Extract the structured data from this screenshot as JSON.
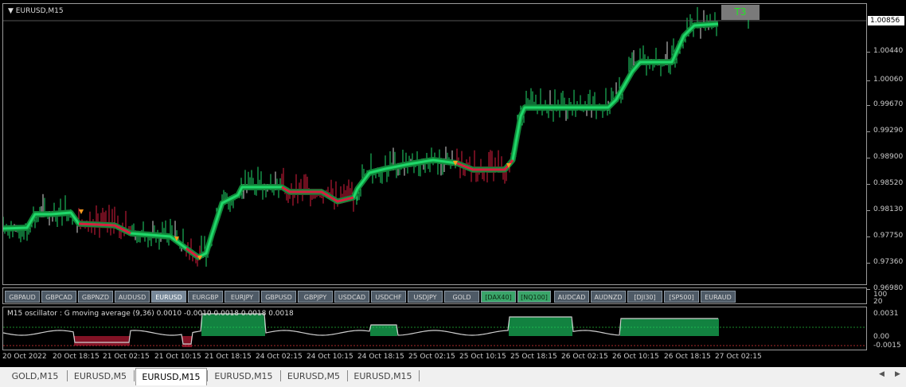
{
  "chart": {
    "title": "EURUSD,M15",
    "indicator_box": "T3",
    "current_price": "1.00856",
    "price_labels": [
      "1.00440",
      "1.00060",
      "0.99670",
      "0.99290",
      "0.98900",
      "0.98520",
      "0.98130",
      "0.97750",
      "0.97360",
      "0.96980"
    ],
    "colors": {
      "bull": "#1fd86a",
      "bear": "#d81e3e",
      "signal": "#ff9a1f",
      "neutral": "#d8d8d8"
    }
  },
  "symbol_buttons": [
    {
      "label": "GBPAUD",
      "state": "normal"
    },
    {
      "label": "GBPCAD",
      "state": "normal"
    },
    {
      "label": "GBPNZD",
      "state": "normal"
    },
    {
      "label": "AUDUSD",
      "state": "normal"
    },
    {
      "label": "EURUSD",
      "state": "active"
    },
    {
      "label": "EURGBP",
      "state": "normal"
    },
    {
      "label": "EURJPY",
      "state": "normal"
    },
    {
      "label": "GBPUSD",
      "state": "normal"
    },
    {
      "label": "GBPJPY",
      "state": "normal"
    },
    {
      "label": "USDCAD",
      "state": "normal"
    },
    {
      "label": "USDCHF",
      "state": "normal"
    },
    {
      "label": "USDJPY",
      "state": "normal"
    },
    {
      "label": "GOLD",
      "state": "normal"
    },
    {
      "label": "[DAX40]",
      "state": "green"
    },
    {
      "label": "[NQ100]",
      "state": "green"
    },
    {
      "label": "AUDCAD",
      "state": "normal"
    },
    {
      "label": "AUDNZD",
      "state": "normal"
    },
    {
      "label": "[DJI30]",
      "state": "normal"
    },
    {
      "label": "[SP500]",
      "state": "normal"
    },
    {
      "label": "EURAUD",
      "state": "normal"
    }
  ],
  "oscillator": {
    "label": "M15  oscillator : G moving average (9,36)  0.0010 -0.0010 0.0018 0.0018 0.0018",
    "scale_labels": [
      "100",
      "20",
      "0.0031",
      "0.00",
      "-0.0015"
    ]
  },
  "time_labels": [
    "20 Oct 2022",
    "20 Oct 18:15",
    "21 Oct 02:15",
    "21 Oct 10:15",
    "21 Oct 18:15",
    "24 Oct 02:15",
    "24 Oct 10:15",
    "24 Oct 18:15",
    "25 Oct 02:15",
    "25 Oct 10:15",
    "25 Oct 18:15",
    "26 Oct 02:15",
    "26 Oct 10:15",
    "26 Oct 18:15",
    "27 Oct 02:15"
  ],
  "tabs": [
    {
      "label": "GOLD,M15",
      "active": false
    },
    {
      "label": "EURUSD,M5",
      "active": false
    },
    {
      "label": "EURUSD,M15",
      "active": true
    },
    {
      "label": "EURUSD,M15",
      "active": false
    },
    {
      "label": "EURUSD,M5",
      "active": false
    },
    {
      "label": "EURUSD,M15",
      "active": false
    }
  ]
}
